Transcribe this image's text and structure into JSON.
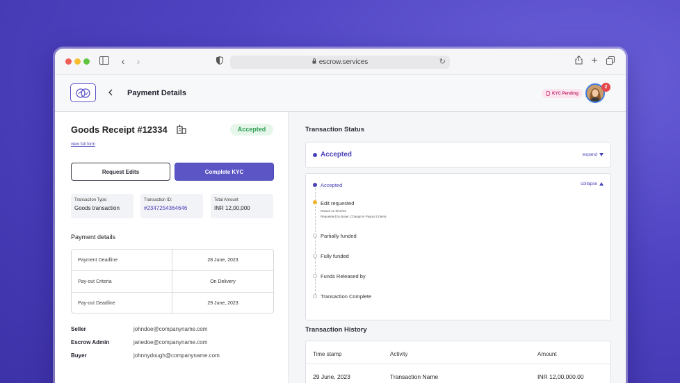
{
  "browser": {
    "url": "escrow.services"
  },
  "header": {
    "title": "Payment Details",
    "kyc_badge": "KYC Pending",
    "notification_count": "2"
  },
  "receipt": {
    "title": "Goods Receipt #12334",
    "status": "Accepted",
    "view_form": "view full form",
    "request_edits": "Request Edits",
    "complete_kyc": "Complete KYC",
    "cards": [
      {
        "label": "Transaction Type:",
        "value": "Goods transaction"
      },
      {
        "label": "Transaction ID:",
        "value": "#2347254364646"
      },
      {
        "label": "Total Amount",
        "value": "INR 12,00,000"
      }
    ]
  },
  "payment_details": {
    "heading": "Payment details",
    "rows": [
      {
        "key": "Payment Deadline",
        "value": "28 June, 2023"
      },
      {
        "key": "Pay-out Criteria",
        "value": "On Delivery"
      },
      {
        "key": "Pay-out Deadline",
        "value": "29 June, 2023"
      }
    ]
  },
  "parties": [
    {
      "role": "Seller",
      "email": "johndoe@companyname.com"
    },
    {
      "role": "Escrow Admin",
      "email": "janedoe@companyname.com"
    },
    {
      "role": "Buyer",
      "email": "johnnydough@companyname.com"
    }
  ],
  "transaction_status": {
    "heading": "Transaction Status",
    "current": "Accepted",
    "expand_label": "expand",
    "collapse_label": "collapse",
    "timeline": [
      {
        "label": "Accepted",
        "state": "done"
      },
      {
        "label": "Edit requested",
        "state": "warn",
        "sub1": "Raised on 5/12/23",
        "sub2": "Requested by Buyer, Change in Payout Criteria"
      },
      {
        "label": "Partially funded",
        "state": "pending"
      },
      {
        "label": "Fully funded",
        "state": "pending"
      },
      {
        "label": "Funds Released by",
        "state": "pending"
      },
      {
        "label": "Transaction Complete",
        "state": "pending"
      }
    ]
  },
  "transaction_history": {
    "heading": "Transaction History",
    "columns": [
      "Time stamp",
      "Activity",
      "Amount"
    ],
    "rows": [
      {
        "timestamp": "29 June, 2023",
        "activity": "Transaction Name",
        "amount": "INR 12,00,000.00"
      }
    ]
  },
  "colors": {
    "accent": "#5b55c6",
    "success": "#2f9e52",
    "warning": "#f0b42a",
    "danger": "#e5484d"
  }
}
